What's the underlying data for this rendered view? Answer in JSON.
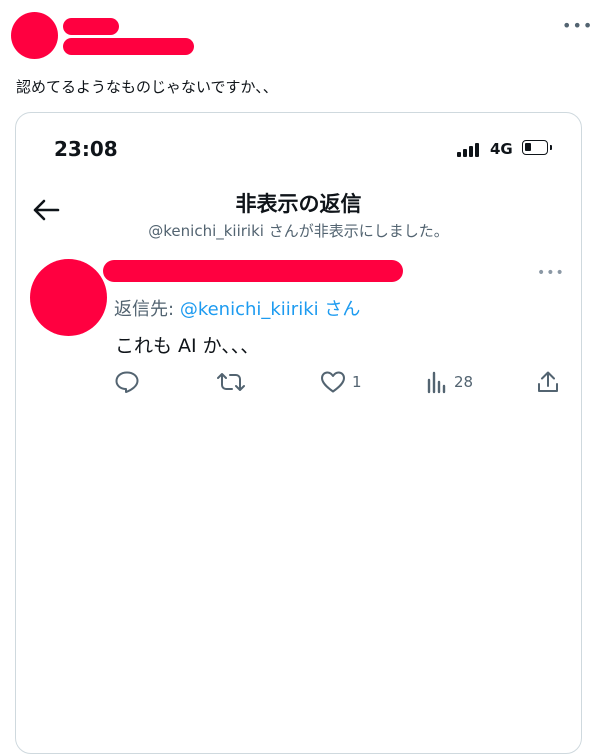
{
  "tweet": {
    "more_icon": "more-horizontal-icon",
    "text": "認めてるようなものじゃないですか、、"
  },
  "card": {
    "status_bar": {
      "time": "23:08",
      "network": "4G",
      "battery_level": 0.3
    },
    "header": {
      "back_icon": "arrow-left-icon",
      "title": "非表示の返信",
      "subtitle": "@kenichi_kiiriki さんが非表示にしました。"
    },
    "reply": {
      "reply_to_label": "返信先:",
      "reply_to_handle": "@kenichi_kiiriki",
      "reply_to_suffix": "さん",
      "text": "これも AI か、、、",
      "actions": {
        "like_count": "1",
        "views_count": "28"
      }
    }
  },
  "colors": {
    "redaction": "#ff0040",
    "link": "#1d9bf0",
    "secondary_text": "#536471",
    "border": "#cfd9de"
  }
}
